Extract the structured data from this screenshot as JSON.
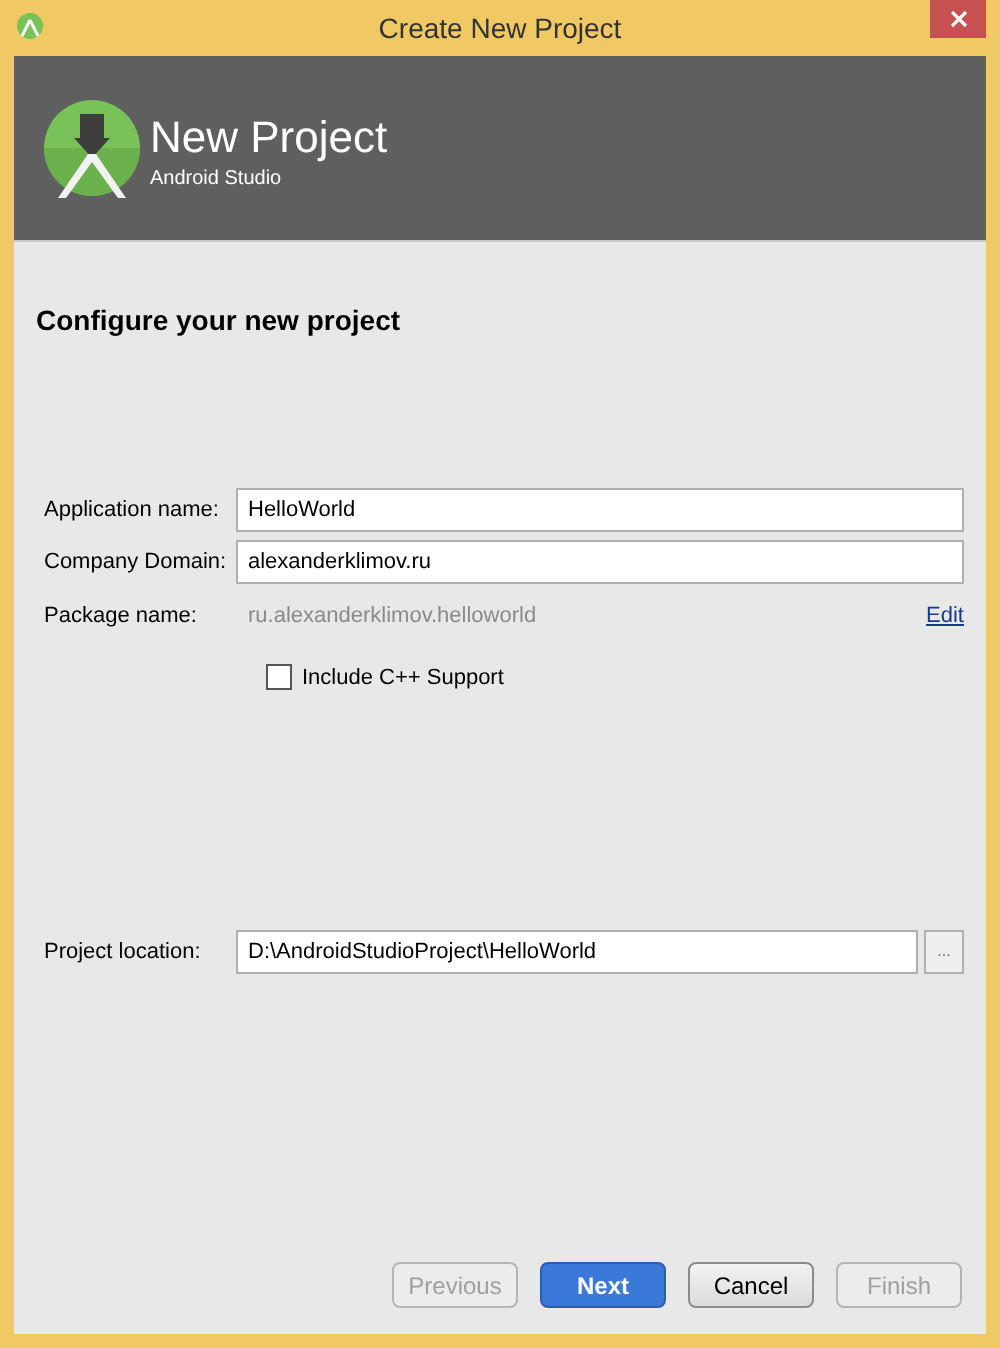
{
  "window": {
    "title": "Create New Project"
  },
  "header": {
    "title": "New Project",
    "subtitle": "Android Studio"
  },
  "heading": "Configure your new project",
  "fields": [
    {
      "label": "Application name:",
      "value": "HelloWorld"
    },
    {
      "label": "Company Domain:",
      "value": "alexanderklimov.ru"
    }
  ],
  "package": {
    "label": "Package name:",
    "value": "ru.alexanderklimov.helloworld",
    "link": "Edit"
  },
  "checkbox": {
    "label": "Include C++ Support",
    "checked": false
  },
  "location": {
    "label": "Project location:",
    "value": "D:\\AndroidStudioProject\\HelloWorld",
    "browse": "..."
  },
  "buttons": [
    {
      "label": "Previous",
      "kind": "normal",
      "disabled": true
    },
    {
      "label": "Next",
      "kind": "primary",
      "disabled": false
    },
    {
      "label": "Cancel",
      "kind": "normal",
      "disabled": false
    },
    {
      "label": "Finish",
      "kind": "normal",
      "disabled": true
    }
  ]
}
